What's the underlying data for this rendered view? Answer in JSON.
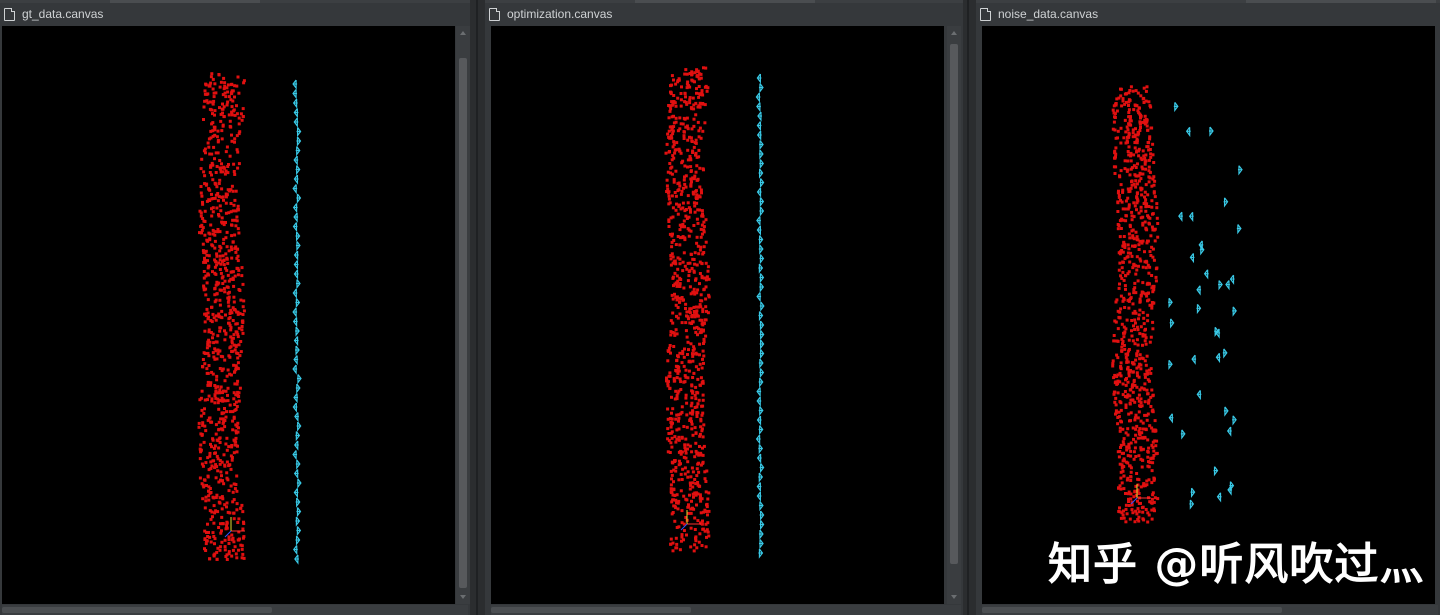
{
  "panels": [
    {
      "title": "gt_data.canvas",
      "cyan_style": "regular_column"
    },
    {
      "title": "optimization.canvas",
      "cyan_style": "regular_column"
    },
    {
      "title": "noise_data.canvas",
      "cyan_style": "scattered"
    }
  ],
  "colors": {
    "background": "#000000",
    "points": "#e01010",
    "poses": "#39c9e6",
    "chrome": "#35383b"
  },
  "icons": [
    "file-icon",
    "scroll-up-arrow-icon",
    "scroll-down-arrow-icon",
    "axis-gizmo-icon"
  ],
  "watermark": "知乎 @听风吹过灬"
}
